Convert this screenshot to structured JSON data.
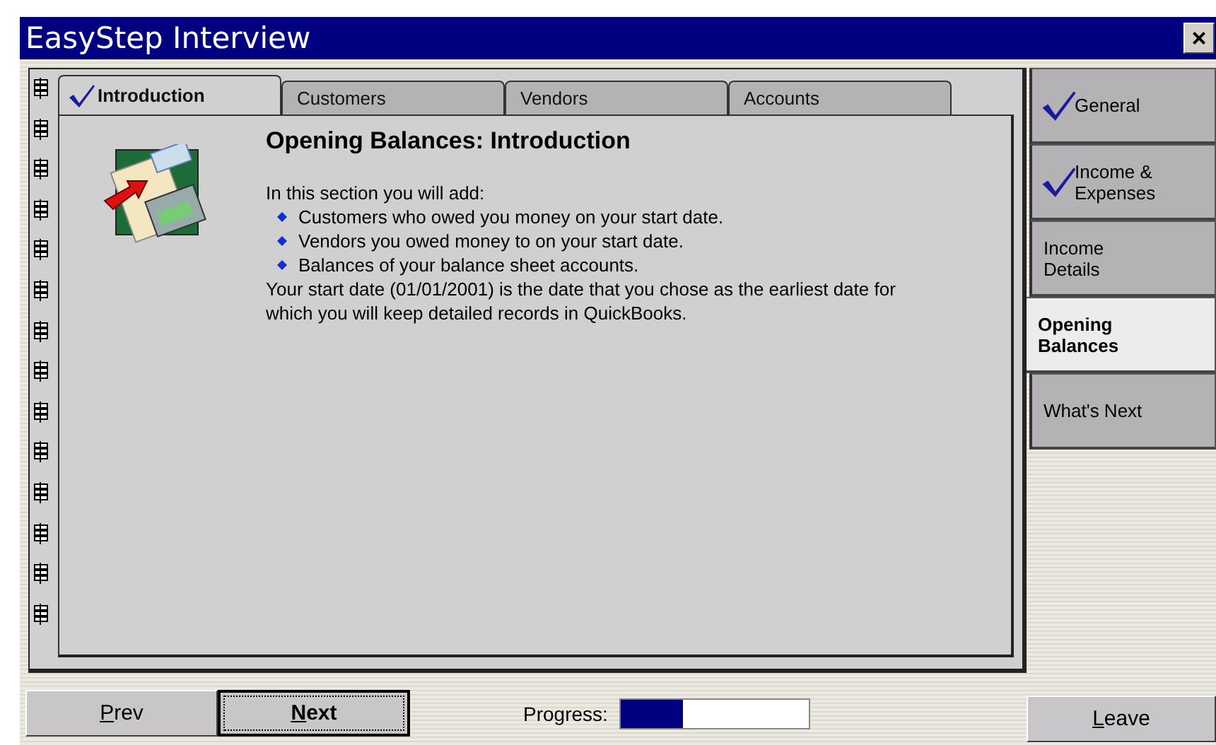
{
  "window": {
    "title": "EasyStep Interview",
    "close": "×"
  },
  "tabs": [
    {
      "label": "Introduction",
      "selected": true,
      "checked": true
    },
    {
      "label": "Customers",
      "selected": false,
      "checked": false
    },
    {
      "label": "Vendors",
      "selected": false,
      "checked": false
    },
    {
      "label": "Accounts",
      "selected": false,
      "checked": false
    }
  ],
  "content": {
    "heading": "Opening Balances: Introduction",
    "intro": "In this section you will add:",
    "bullets": [
      "Customers who owed you money on your start date.",
      "Vendors you owed money to on your start date.",
      "Balances of your balance sheet accounts."
    ],
    "note": "Your start date (01/01/2001) is the date that you chose as the earliest date for which you will keep detailed records in QuickBooks."
  },
  "sections": [
    {
      "label": "General",
      "selected": false,
      "checked": true
    },
    {
      "label": "Income & Expenses",
      "selected": false,
      "checked": true
    },
    {
      "label": "Income Details",
      "selected": false,
      "checked": false
    },
    {
      "label": "Opening Balances",
      "selected": true,
      "checked": false
    },
    {
      "label": "What's Next",
      "selected": false,
      "checked": false
    }
  ],
  "buttons": [
    {
      "label": "Prev",
      "default": false,
      "underline_first": true
    },
    {
      "label": "Next",
      "default": true,
      "underline_first": true
    }
  ],
  "progress": {
    "label": "Progress:",
    "level": 0.33
  },
  "leave": {
    "label": "Leave",
    "underline_first": true
  }
}
